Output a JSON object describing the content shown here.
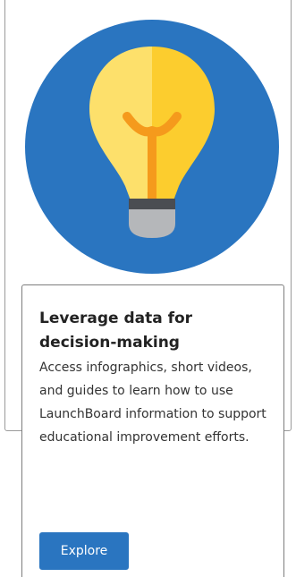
{
  "card": {
    "image_icon": "lightbulb-icon",
    "title": "Leverage data for decision-making",
    "description": "Access infographics, short videos, and guides to learn how to use LaunchBoard information to support educational improvement efforts.",
    "button_label": "Explore"
  },
  "colors": {
    "circle_blue": "#2a75c0",
    "bulb_light": "#fde06b",
    "bulb_bright": "#fccd2e",
    "filament": "#f59a1c",
    "cap_dark": "#4a4d52",
    "cap_light": "#b5b7ba",
    "button_blue": "#2a75c0"
  }
}
